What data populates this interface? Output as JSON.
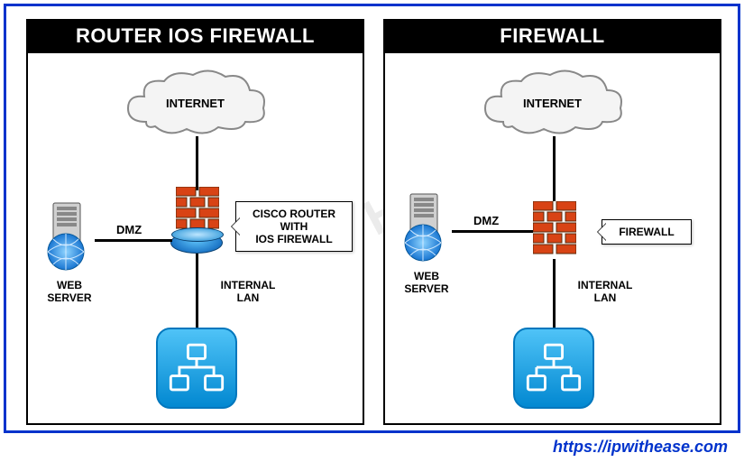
{
  "left_panel_title": "ROUTER IOS FIREWALL",
  "right_panel_title": "FIREWALL",
  "internet_label": "INTERNET",
  "dmz_label": "DMZ",
  "web_server_label": "WEB\nSERVER",
  "internal_lan_label": "INTERNAL\nLAN",
  "left_callout": "CISCO ROUTER\nWITH\nIOS FIREWALL",
  "right_callout": "FIREWALL",
  "url": "https://ipwithease.com",
  "watermark": "WWW.IPWITHEASE.COM"
}
